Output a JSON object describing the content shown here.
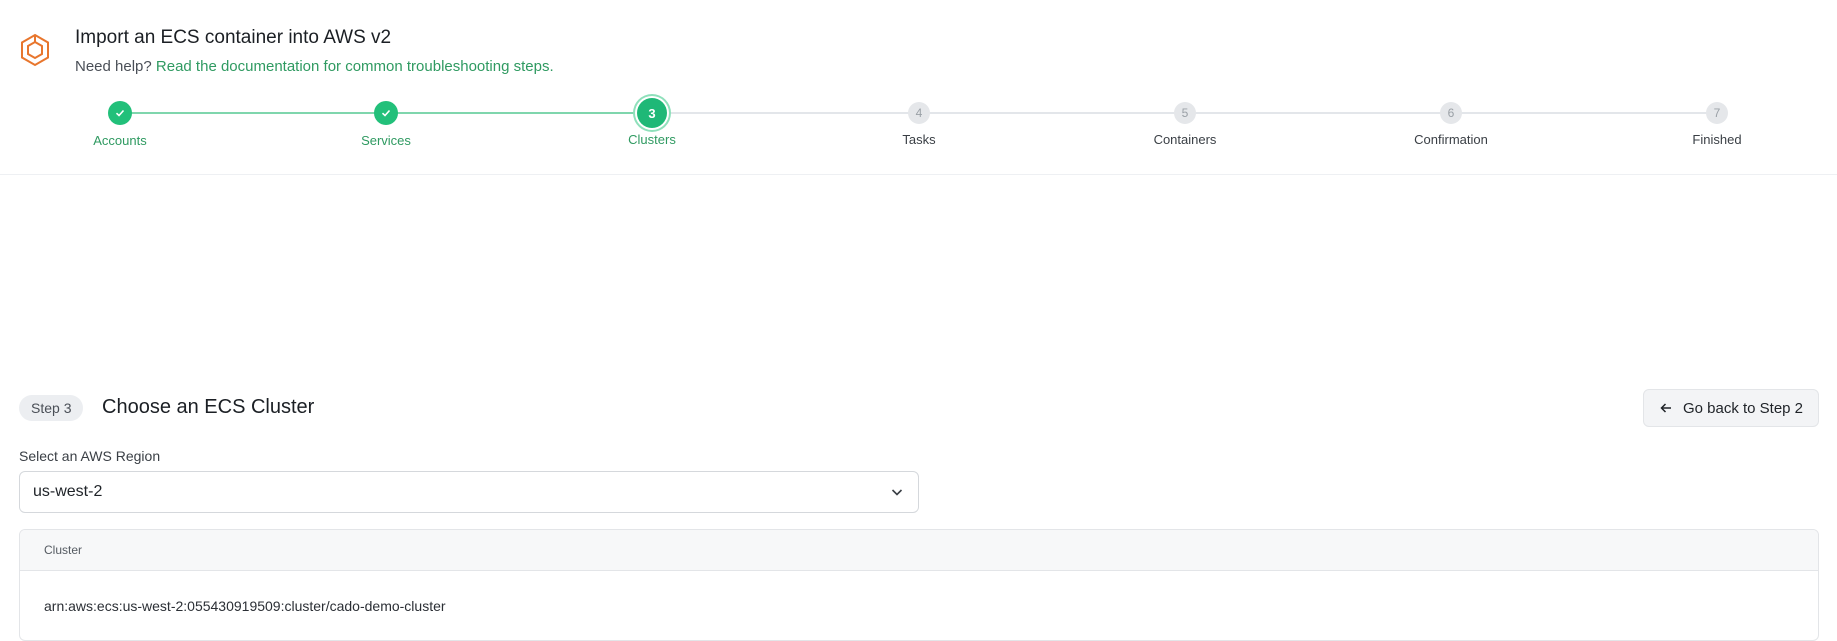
{
  "header": {
    "title": "Import an ECS container into AWS v2",
    "help_prefix": "Need help?",
    "help_link": "Read the documentation for common troubleshooting steps."
  },
  "stepper": {
    "steps": [
      {
        "label": "Accounts",
        "state": "done",
        "number": "1"
      },
      {
        "label": "Services",
        "state": "done",
        "number": "2"
      },
      {
        "label": "Clusters",
        "state": "current",
        "number": "3"
      },
      {
        "label": "Tasks",
        "state": "todo",
        "number": "4"
      },
      {
        "label": "Containers",
        "state": "todo",
        "number": "5"
      },
      {
        "label": "Confirmation",
        "state": "todo",
        "number": "6"
      },
      {
        "label": "Finished",
        "state": "todo",
        "number": "7"
      }
    ]
  },
  "main": {
    "step_badge": "Step 3",
    "title": "Choose an ECS Cluster",
    "back_button": "Go back to Step 2",
    "region_label": "Select an AWS Region",
    "region_value": "us-west-2",
    "table": {
      "column": "Cluster",
      "rows": [
        "arn:aws:ecs:us-west-2:055430919509:cluster/cado-demo-cluster"
      ]
    }
  },
  "icons": {
    "logo": "hexagon-logo-icon",
    "check": "check-icon",
    "chevron": "chevron-down-icon",
    "back": "arrow-left-icon"
  },
  "colors": {
    "accent": "#22c07a",
    "link": "#2f9a61",
    "logo": "#e8762d"
  }
}
